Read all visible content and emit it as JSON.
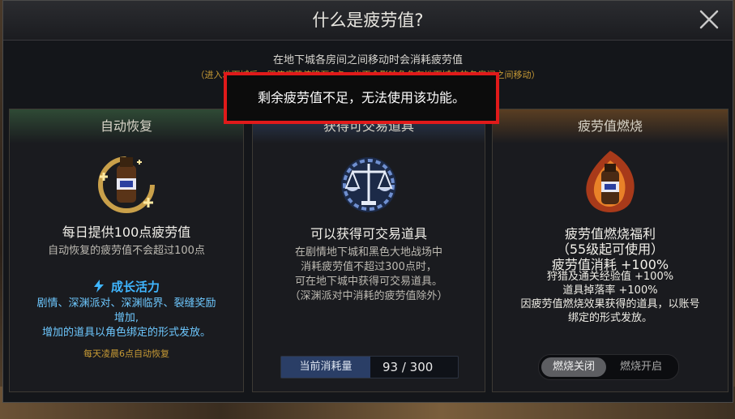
{
  "dialog": {
    "title": "什么是疲劳值?",
    "description": "在地下城各房间之间移动时会消耗疲劳值",
    "sub_description": "（进入地下城后，即使疲劳值降至0点，也不会影响角色在地下城中的各房间之间移动）"
  },
  "toast": {
    "message": "剩余疲劳值不足，无法使用该功能。"
  },
  "cards": {
    "auto_recovery": {
      "header": "自动恢复",
      "main": "每日提供100点疲劳值",
      "note": "自动恢复的疲劳值不会超过100点",
      "boost_label": "成长活力",
      "boost_lines": [
        "剧情、深渊派对、深渊临界、裂缝奖励",
        "增加,",
        "增加的道具以角色绑定的形式发放。"
      ],
      "footer": "每天凌晨6点自动恢复"
    },
    "tradable": {
      "header": "获得可交易道具",
      "main": "可以获得可交易道具",
      "lines": [
        "在剧情地下城和黑色大地战场中",
        "消耗疲劳值不超过300点时，",
        "可在地下城中获得可交易道具。",
        "（深渊派对中消耗的疲劳值除外）"
      ],
      "usage_label": "当前消耗量",
      "usage_value": "93 / 300"
    },
    "burn": {
      "header": "疲劳值燃烧",
      "main_lines": [
        "疲劳值燃烧福利",
        "（55级起可使用）",
        "疲劳值消耗 +100%"
      ],
      "lines": [
        "狩猎及通关经验值 +100%",
        "道具掉落率 +100%",
        "因疲劳值燃烧效果获得的道具，以账号",
        "绑定的形式发放。"
      ],
      "toggle_off": "燃烧关闭",
      "toggle_on": "燃烧开启",
      "selected": "燃烧关闭"
    }
  },
  "icons": {
    "close": "close-icon",
    "recovery": "potion-recovery-icon",
    "scale": "scale-icon",
    "burn": "burning-potion-icon",
    "bolt": "lightning-icon"
  }
}
